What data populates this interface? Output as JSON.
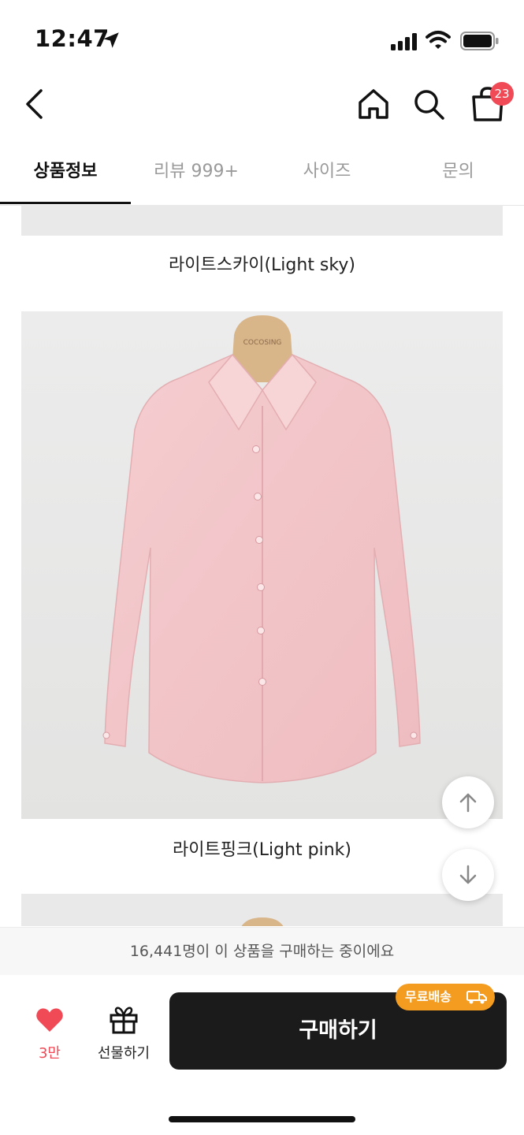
{
  "status_bar": {
    "time": "12:47"
  },
  "nav": {
    "cart_count": "23"
  },
  "tabs": [
    {
      "label": "상품정보",
      "active": true
    },
    {
      "label": "리뷰 999+",
      "active": false
    },
    {
      "label": "사이즈",
      "active": false
    },
    {
      "label": "문의",
      "active": false
    }
  ],
  "content": {
    "caption_1": "라이트스카이(Light sky)",
    "caption_2": "라이트핑크(Light pink)",
    "hanger_brand": "COCOSING"
  },
  "footer": {
    "buyers_notice": "16,441명이 이 상품을 구매하는 중이에요",
    "like_count": "3만",
    "gift_label": "선물하기",
    "buy_label": "구매하기",
    "free_shipping_label": "무료배송"
  },
  "colors": {
    "accent_red": "#f04a57",
    "buy_button": "#1b1b1b",
    "free_shipping": "#f39c1f",
    "shirt_pink": "#f2c6c9"
  }
}
